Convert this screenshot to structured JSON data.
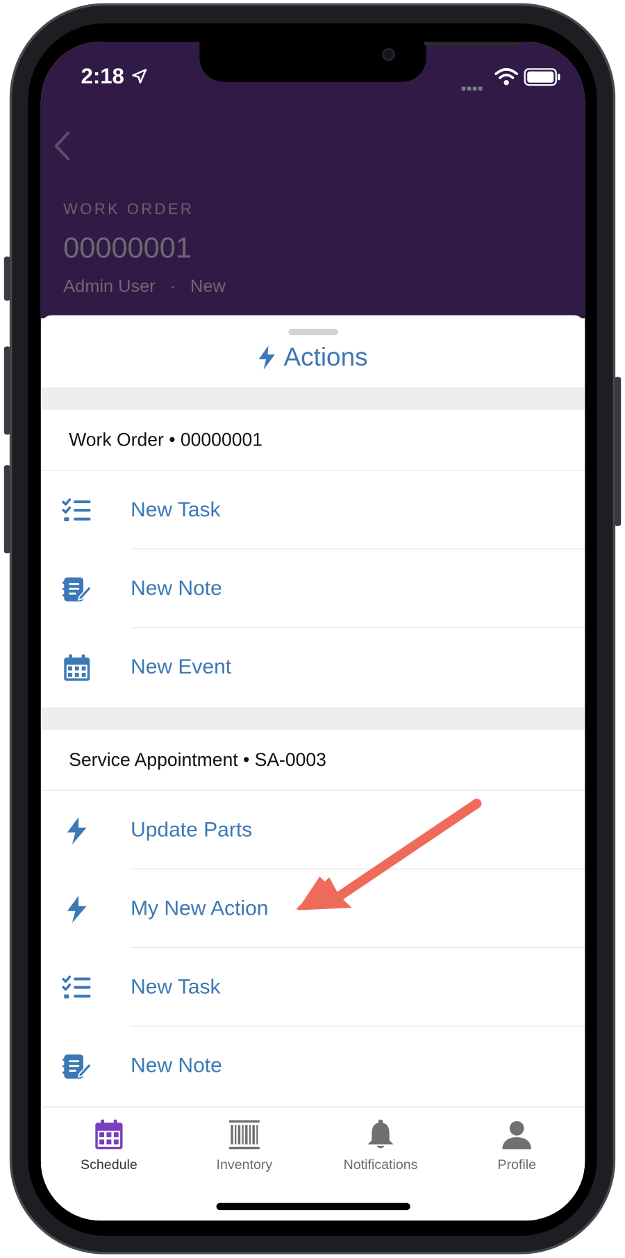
{
  "status_bar": {
    "time": "2:18"
  },
  "header": {
    "record_type": "WORK ORDER",
    "record_number": "00000001",
    "owner": "Admin User",
    "separator": "·",
    "status": "New"
  },
  "sheet": {
    "title": "Actions"
  },
  "sections": [
    {
      "header": "Work Order • 00000001",
      "items": [
        {
          "label": "New Task",
          "icon": "task-list-icon"
        },
        {
          "label": "New Note",
          "icon": "note-icon"
        },
        {
          "label": "New Event",
          "icon": "calendar-icon"
        }
      ]
    },
    {
      "header": "Service Appointment • SA-0003",
      "items": [
        {
          "label": "Update Parts",
          "icon": "lightning-icon"
        },
        {
          "label": "My New Action",
          "icon": "lightning-icon"
        },
        {
          "label": "New Task",
          "icon": "task-list-icon"
        },
        {
          "label": "New Note",
          "icon": "note-icon"
        }
      ]
    }
  ],
  "tabbar": {
    "tabs": [
      {
        "label": "Schedule",
        "icon": "calendar-icon",
        "active": true
      },
      {
        "label": "Inventory",
        "icon": "barcode-icon"
      },
      {
        "label": "Notifications",
        "icon": "bell-icon"
      },
      {
        "label": "Profile",
        "icon": "person-icon"
      }
    ]
  },
  "colors": {
    "header_bg": "#311b46",
    "action_blue": "#3c78b5",
    "schedule_purple": "#7a3fbf",
    "arrow": "#ee6b5b",
    "section_gap": "#eeeeee"
  }
}
